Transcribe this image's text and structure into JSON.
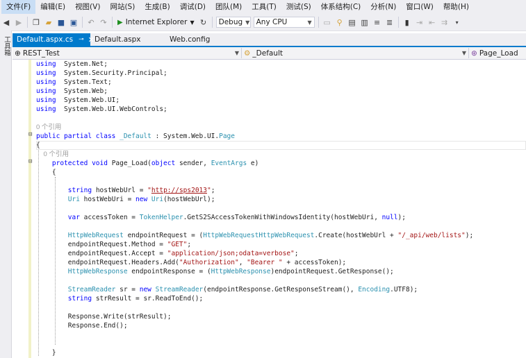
{
  "menu": [
    "文件(F)",
    "编辑(E)",
    "视图(V)",
    "网站(S)",
    "生成(B)",
    "调试(D)",
    "团队(M)",
    "工具(T)",
    "测试(S)",
    "体系结构(C)",
    "分析(N)",
    "窗口(W)",
    "帮助(H)"
  ],
  "toolbar": {
    "run_label": "Internet Explorer",
    "config": "Debug",
    "platform": "Any CPU"
  },
  "left_strip_label": "工具箱",
  "tabs": [
    {
      "label": "Default.aspx.cs",
      "active": true
    },
    {
      "label": "Default.aspx",
      "active": false
    },
    {
      "label": "Web.config",
      "active": false
    }
  ],
  "navbar": {
    "project": "REST_Test",
    "class": "_Default",
    "member": "Page_Load"
  },
  "code_lines": [
    [
      [
        "kw",
        "using"
      ],
      [
        "",
        "  System.Net;"
      ]
    ],
    [
      [
        "kw",
        "using"
      ],
      [
        "",
        "  System.Security.Principal;"
      ]
    ],
    [
      [
        "kw",
        "using"
      ],
      [
        "",
        "  System.Text;"
      ]
    ],
    [
      [
        "kw",
        "using"
      ],
      [
        "",
        "  System.Web;"
      ]
    ],
    [
      [
        "kw",
        "using"
      ],
      [
        "",
        "  System.Web.UI;"
      ]
    ],
    [
      [
        "kw",
        "using"
      ],
      [
        "",
        "  System.Web.UI.WebControls;"
      ]
    ],
    [],
    [
      [
        "ref",
        "0 个引用"
      ]
    ],
    [
      [
        "kw",
        "public partial class "
      ],
      [
        "ty",
        "_Default"
      ],
      [
        "",
        " : System.Web.UI."
      ],
      [
        "ty",
        "Page"
      ]
    ],
    [
      [
        "",
        "{"
      ]
    ],
    [
      [
        "ref",
        "    0 个引用"
      ]
    ],
    [
      [
        "",
        "    "
      ],
      [
        "kw",
        "protected void"
      ],
      [
        "",
        " Page_Load("
      ],
      [
        "kw",
        "object"
      ],
      [
        "",
        " sender, "
      ],
      [
        "ty",
        "EventArgs"
      ],
      [
        "",
        " e)"
      ]
    ],
    [
      [
        "",
        "    {"
      ]
    ],
    [],
    [
      [
        "",
        "        "
      ],
      [
        "kw",
        "string"
      ],
      [
        "",
        " hostWebUrl = "
      ],
      [
        "st",
        "\""
      ],
      [
        "url",
        "http://sps2013"
      ],
      [
        "st",
        "\""
      ],
      [
        "",
        ";"
      ]
    ],
    [
      [
        "",
        "        "
      ],
      [
        "ty",
        "Uri"
      ],
      [
        "",
        " hostWebUri = "
      ],
      [
        "kw",
        "new "
      ],
      [
        "ty",
        "Uri"
      ],
      [
        "",
        "(hostWebUrl);"
      ]
    ],
    [],
    [
      [
        "",
        "        "
      ],
      [
        "kw",
        "var"
      ],
      [
        "",
        " accessToken = "
      ],
      [
        "ty",
        "TokenHelper"
      ],
      [
        "",
        ".GetS2SAccessTokenWithWindowsIdentity(hostWebUri, "
      ],
      [
        "kw",
        "null"
      ],
      [
        "",
        ");"
      ]
    ],
    [],
    [
      [
        "",
        "        "
      ],
      [
        "ty",
        "HttpWebRequest"
      ],
      [
        "",
        " endpointRequest = ("
      ],
      [
        "ty",
        "HttpWebRequest"
      ],
      [
        ")"
      ],
      [
        "ty",
        "HttpWebRequest"
      ],
      [
        "",
        ".Create(hostWebUrl + "
      ],
      [
        "st",
        "\"/_api/web/lists\""
      ],
      [
        "",
        ");"
      ]
    ],
    [
      [
        "",
        "        endpointRequest.Method = "
      ],
      [
        "st",
        "\"GET\""
      ],
      [
        "",
        ";"
      ]
    ],
    [
      [
        "",
        "        endpointRequest.Accept = "
      ],
      [
        "st",
        "\"application/json;odata=verbose\""
      ],
      [
        "",
        ";"
      ]
    ],
    [
      [
        "",
        "        endpointRequest.Headers.Add("
      ],
      [
        "st",
        "\"Authorization\""
      ],
      [
        "",
        ", "
      ],
      [
        "st",
        "\"Bearer \""
      ],
      [
        "",
        " + accessToken);"
      ]
    ],
    [
      [
        "",
        "        "
      ],
      [
        "ty",
        "HttpWebResponse"
      ],
      [
        "",
        " endpointResponse = ("
      ],
      [
        "ty",
        "HttpWebResponse"
      ],
      [
        "",
        ")endpointRequest.GetResponse();"
      ]
    ],
    [],
    [
      [
        "",
        "        "
      ],
      [
        "ty",
        "StreamReader"
      ],
      [
        "",
        " sr = "
      ],
      [
        "kw",
        "new "
      ],
      [
        "ty",
        "StreamReader"
      ],
      [
        "",
        "(endpointResponse.GetResponseStream(), "
      ],
      [
        "ty",
        "Encoding"
      ],
      [
        "",
        ".UTF8);"
      ]
    ],
    [
      [
        "",
        "        "
      ],
      [
        "kw",
        "string"
      ],
      [
        "",
        " strResult = sr.ReadToEnd();"
      ]
    ],
    [],
    [
      [
        "",
        "        Response.Write(strResult);"
      ]
    ],
    [
      [
        "",
        "        Response.End();"
      ]
    ],
    [],
    [],
    [
      [
        "",
        "    }"
      ]
    ],
    [
      [
        "",
        "}"
      ]
    ]
  ]
}
